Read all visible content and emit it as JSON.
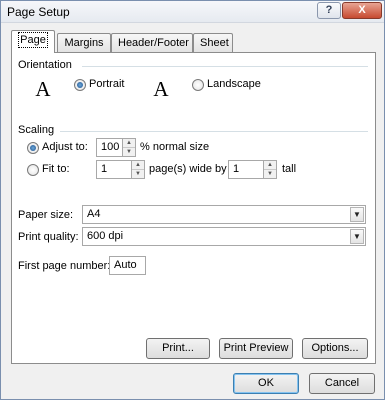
{
  "window": {
    "title": "Page Setup",
    "help_label": "?",
    "close_label": "X"
  },
  "tabs": [
    {
      "label": "Page"
    },
    {
      "label": "Margins"
    },
    {
      "label": "Header/Footer"
    },
    {
      "label": "Sheet"
    }
  ],
  "orientation": {
    "group_label": "Orientation",
    "portrait_icon": "A",
    "portrait_label": "Portrait",
    "landscape_icon": "A",
    "landscape_label": "Landscape",
    "selected": "portrait"
  },
  "scaling": {
    "group_label": "Scaling",
    "adjust_label": "Adjust to:",
    "adjust_value": "100",
    "adjust_suffix": "% normal size",
    "fit_label": "Fit to:",
    "fit_wide_value": "1",
    "fit_wide_suffix": "page(s) wide by",
    "fit_tall_value": "1",
    "fit_tall_suffix": "tall",
    "selected": "adjust"
  },
  "paper": {
    "paper_size_label": "Paper size:",
    "paper_size_value": "A4",
    "print_quality_label": "Print quality:",
    "print_quality_value": "600 dpi",
    "first_page_label": "First page number:",
    "first_page_value": "Auto"
  },
  "panel_buttons": {
    "print": "Print...",
    "print_preview": "Print Preview",
    "options": "Options..."
  },
  "dialog_buttons": {
    "ok": "OK",
    "cancel": "Cancel"
  },
  "colors": {
    "accent": "#1b4f8f",
    "group_line": "#d5dfe5",
    "close": "#c74a30"
  }
}
